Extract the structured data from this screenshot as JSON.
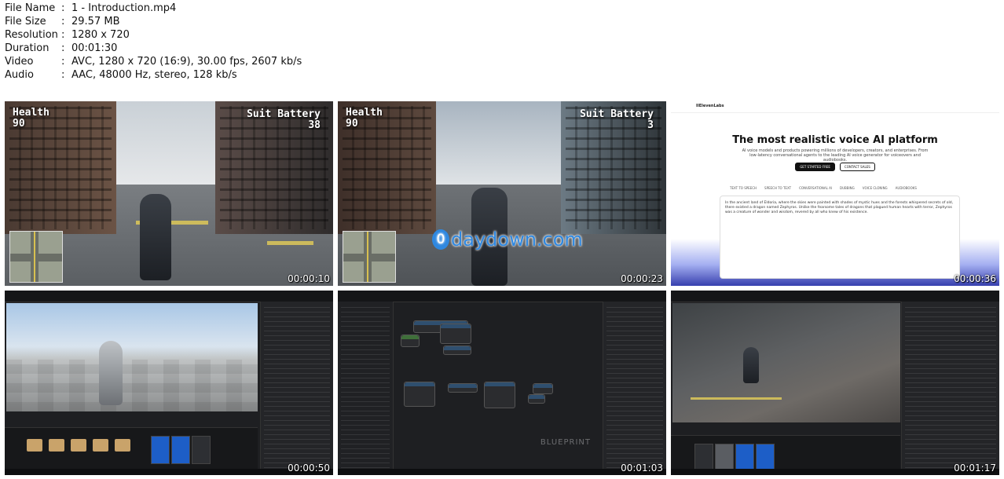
{
  "info": [
    {
      "key": "File Name",
      "sep": ":",
      "value": "1 - Introduction.mp4"
    },
    {
      "key": "File Size",
      "sep": ":",
      "value": "29.57 MB"
    },
    {
      "key": "Resolution",
      "sep": ":",
      "value": "1280 x 720"
    },
    {
      "key": "Duration",
      "sep": ":",
      "value": "00:01:30"
    },
    {
      "key": "Video",
      "sep": ":",
      "value": "AVC, 1280 x 720 (16:9), 30.00 fps, 2607 kb/s"
    },
    {
      "key": "Audio",
      "sep": ":",
      "value": "AAC, 48000 Hz, stereo, 128 kb/s"
    }
  ],
  "thumbs": [
    {
      "timestamp": "00:00:10",
      "hud": {
        "health_label": "Health",
        "health_value": "90",
        "battery_label": "Suit Battery",
        "battery_value": "38"
      }
    },
    {
      "timestamp": "00:00:23",
      "hud": {
        "health_label": "Health",
        "health_value": "90",
        "battery_label": "Suit Battery",
        "battery_value": "3"
      },
      "watermark": {
        "mark": "0",
        "text": "daydown.com"
      }
    },
    {
      "timestamp": "00:00:36",
      "web": {
        "brand": "IIElevenLabs",
        "title": "The most realistic voice AI platform",
        "subtitle": "AI voice models and products powering millions of developers, creators, and enterprises. From low-latency conversational agents to the leading AI voice generator for voiceovers and audiobooks.",
        "btn_primary": "GET STARTED FREE",
        "btn_secondary": "CONTACT SALES",
        "tabs": [
          "TEXT TO SPEECH",
          "SPEECH TO TEXT",
          "CONVERSATIONAL AI",
          "DUBBING",
          "VOICE CLONING",
          "AUDIOBOOKS"
        ],
        "card_text": "In the ancient land of Eldoria, where the skies were painted with shades of mystic hues and the forests whispered secrets of old, there existed a dragon named Zephyros. Unlike the fearsome tales of dragons that plagued human hearts with terror, Zephyros was a creature of wonder and wisdom, revered by all who knew of his existence."
      }
    },
    {
      "timestamp": "00:00:50"
    },
    {
      "timestamp": "00:01:03",
      "watermark": "BLUEPRINT"
    },
    {
      "timestamp": "00:01:17"
    }
  ]
}
